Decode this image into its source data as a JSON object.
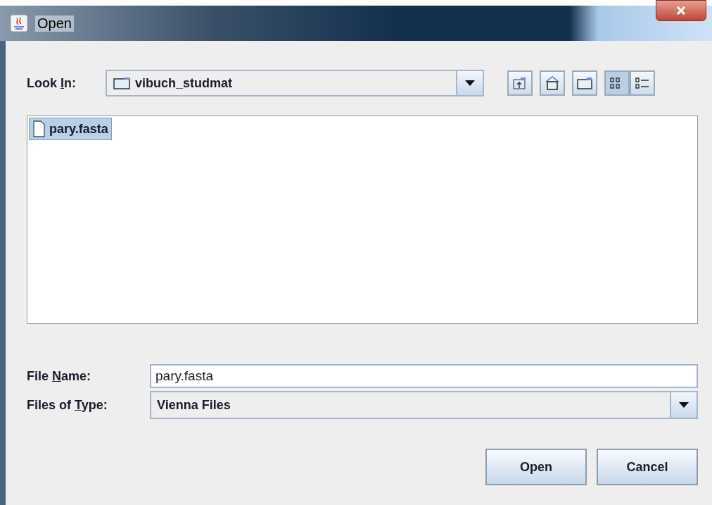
{
  "window": {
    "title": "Open"
  },
  "look_in": {
    "label_parts": [
      "Look ",
      "I",
      "n:"
    ],
    "value": "vibuch_studmat"
  },
  "toolbar": [
    {
      "kind": "up"
    },
    {
      "kind": "home"
    },
    {
      "kind": "new-folder"
    },
    {
      "kind": "list",
      "selected": true
    },
    {
      "kind": "details",
      "selected": false
    }
  ],
  "files": [
    {
      "name": "pary.fasta",
      "selected": true
    }
  ],
  "file_name": {
    "label_parts": [
      "File ",
      "N",
      "ame:"
    ],
    "value": "pary.fasta"
  },
  "file_type": {
    "label_parts": [
      "Files of ",
      "T",
      "ype:"
    ],
    "value": "Vienna Files"
  },
  "buttons": [
    "Open",
    "Cancel"
  ]
}
